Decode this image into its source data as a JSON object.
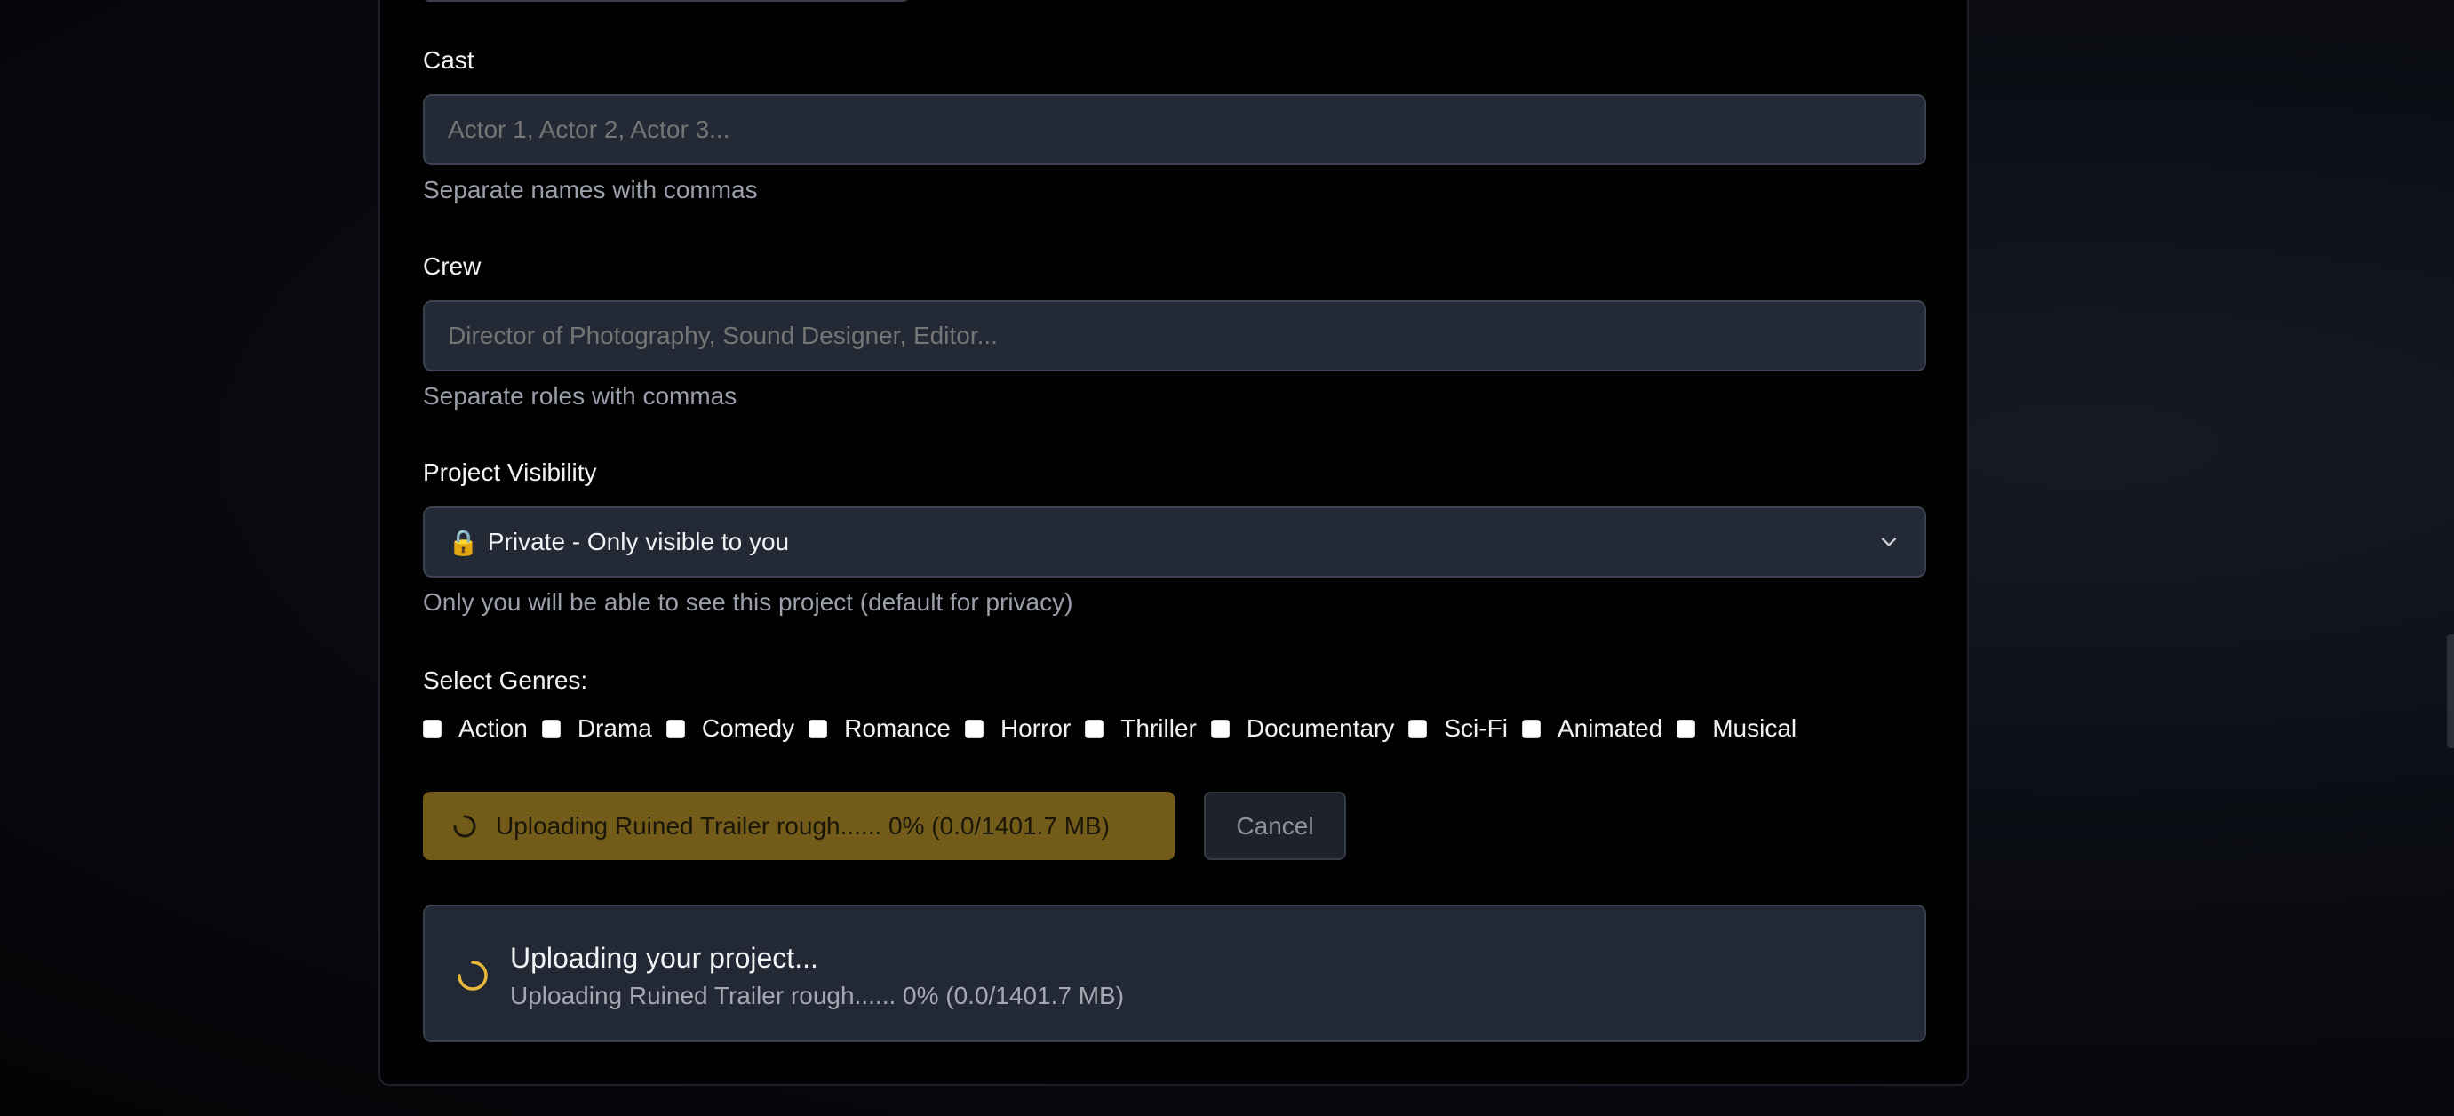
{
  "cast": {
    "label": "Cast",
    "placeholder": "Actor 1, Actor 2, Actor 3...",
    "help": "Separate names with commas"
  },
  "crew": {
    "label": "Crew",
    "placeholder": "Director of Photography, Sound Designer, Editor...",
    "help": "Separate roles with commas"
  },
  "visibility": {
    "label": "Project Visibility",
    "selected_icon": "🔒",
    "selected": "Private - Only visible to you",
    "help": "Only you will be able to see this project (default for privacy)"
  },
  "genres": {
    "label": "Select Genres:",
    "items": [
      "Action",
      "Drama",
      "Comedy",
      "Romance",
      "Horror",
      "Thriller",
      "Documentary",
      "Sci-Fi",
      "Animated",
      "Musical"
    ]
  },
  "upload": {
    "button_label": "Uploading Ruined Trailer rough...... 0% (0.0/1401.7 MB)",
    "cancel_label": "Cancel",
    "status_title": "Uploading your project...",
    "status_detail": "Uploading Ruined Trailer rough...... 0% (0.0/1401.7 MB)"
  },
  "colors": {
    "accent": "#735c1a",
    "spinner": "#e8b83a"
  }
}
